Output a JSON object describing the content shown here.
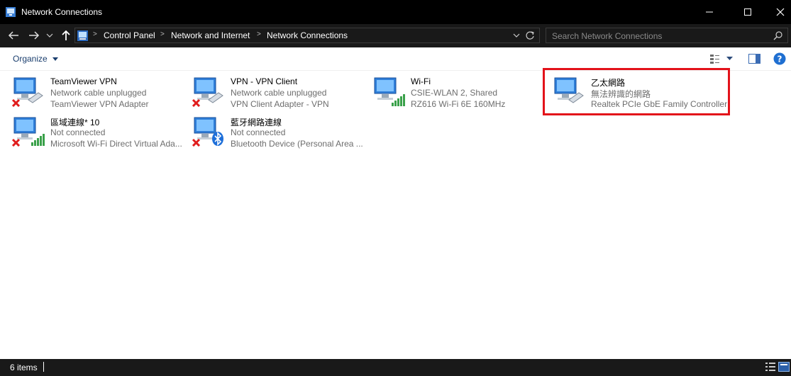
{
  "window": {
    "title": "Network Connections",
    "minimize_icon": "minimize-icon",
    "maximize_icon": "maximize-icon",
    "close_icon": "close-icon"
  },
  "breadcrumb": [
    "Control Panel",
    "Network and Internet",
    "Network Connections"
  ],
  "search": {
    "placeholder": "Search Network Connections"
  },
  "command_bar": {
    "organize_label": "Organize"
  },
  "connections": [
    {
      "name": "TeamViewer VPN",
      "status": "Network cable unplugged",
      "device": "TeamViewer VPN Adapter",
      "badge": "error-x-icon"
    },
    {
      "name": "VPN - VPN Client",
      "status": "Network cable unplugged",
      "device": "VPN Client Adapter - VPN",
      "badge": "error-x-icon"
    },
    {
      "name": "Wi-Fi",
      "status": "CSIE-WLAN 2, Shared",
      "device": "RZ616 Wi-Fi 6E 160MHz",
      "badge": "wifi-signal-icon"
    },
    {
      "name": "乙太網路",
      "status": "無法辨識的網路",
      "device": "Realtek PCIe GbE Family Controller",
      "badge": "ethernet-cable-icon"
    },
    {
      "name": "區域連線* 10",
      "status": "Not connected",
      "device": "Microsoft Wi-Fi Direct Virtual Ada...",
      "badge": "error-x-icon"
    },
    {
      "name": "藍牙網路連線",
      "status": "Not connected",
      "device": "Bluetooth Device (Personal Area ...",
      "badge": "bluetooth-icon"
    }
  ],
  "status_bar": {
    "item_count": "6 items"
  },
  "colors": {
    "highlight_border": "#e3121a",
    "titlebar_bg": "#000000",
    "addressbar_bg": "#191919"
  }
}
